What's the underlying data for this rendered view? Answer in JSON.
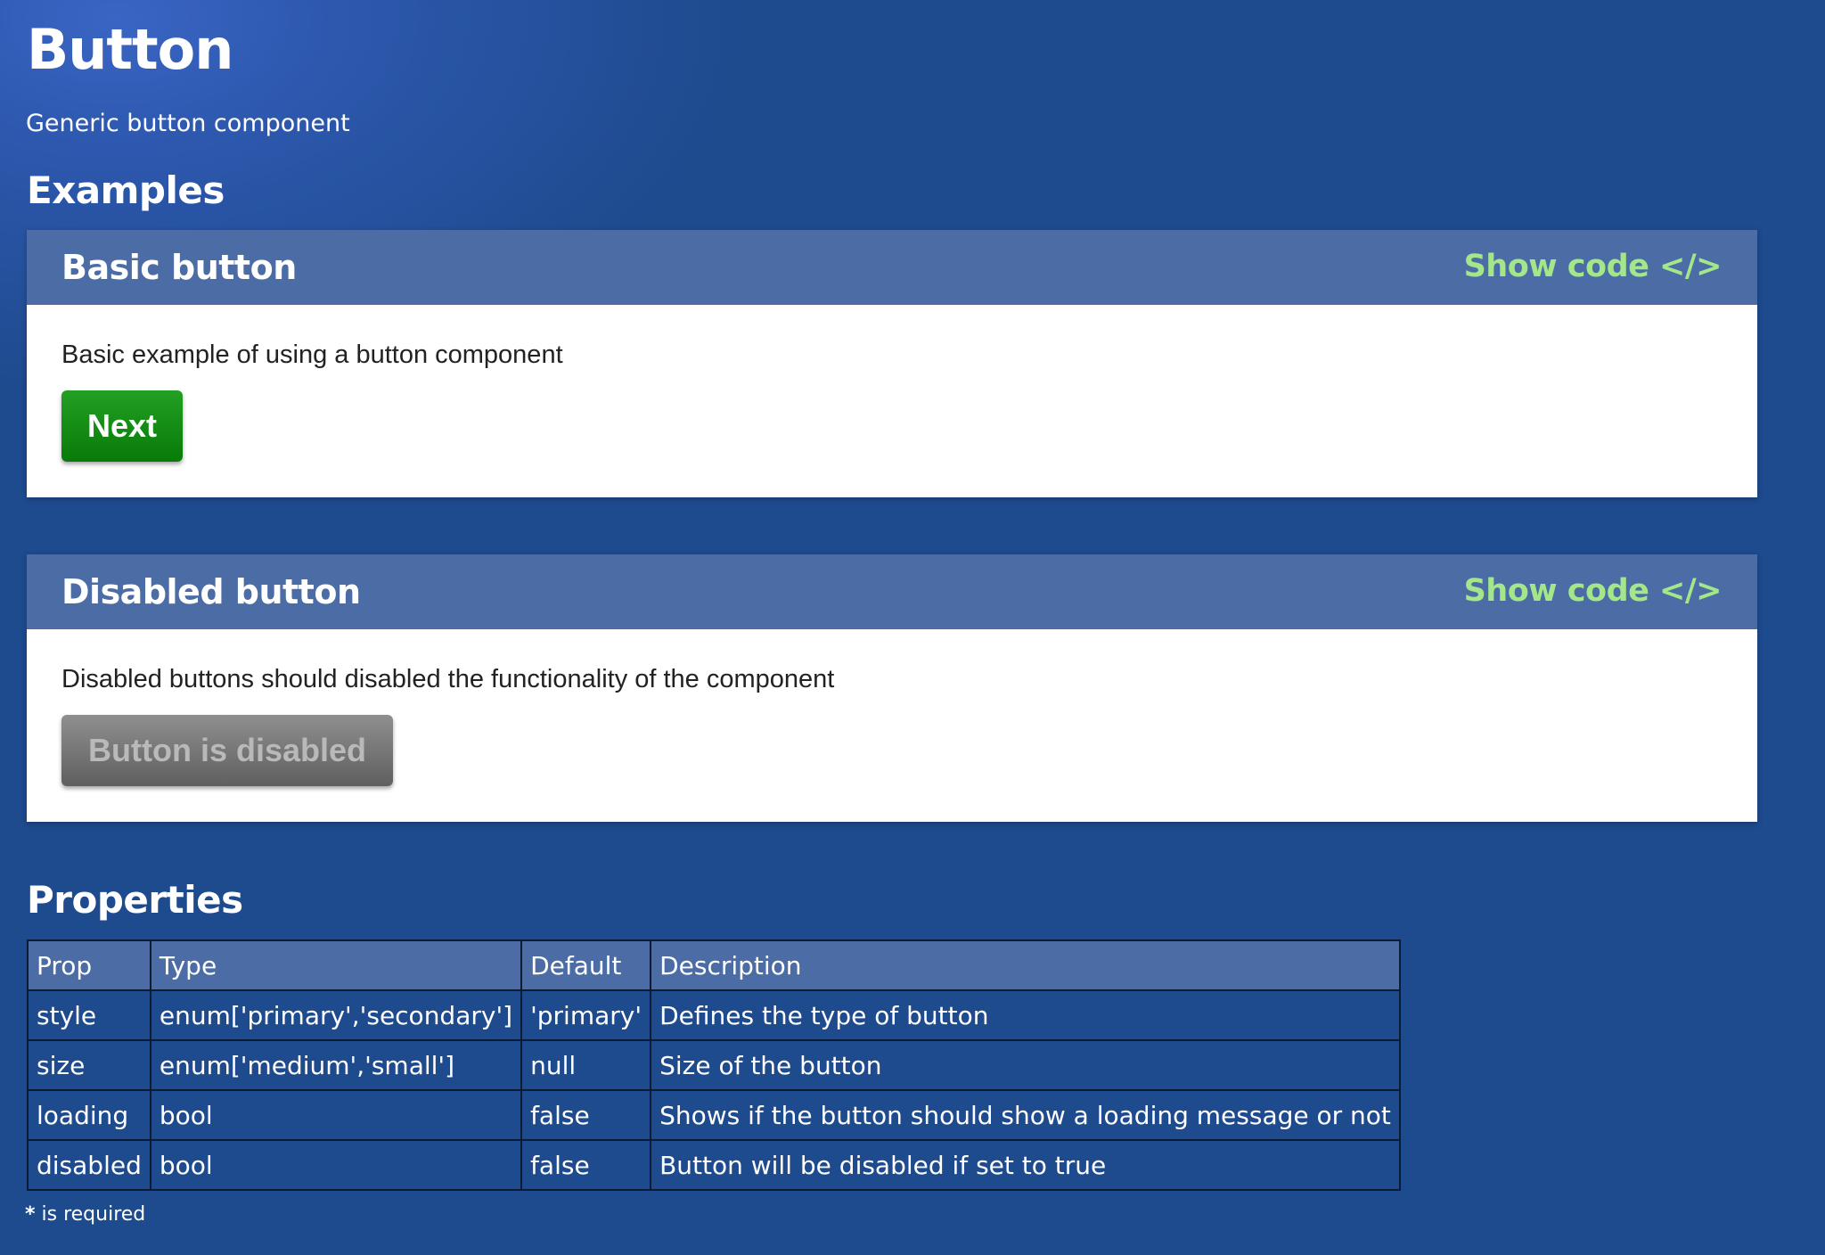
{
  "page": {
    "title": "Button",
    "subtitle": "Generic button component"
  },
  "sections": {
    "examples": "Examples",
    "properties": "Properties"
  },
  "examples": [
    {
      "title": "Basic button",
      "show_code": "Show code </>",
      "description": "Basic example of using a button component",
      "button_label": "Next",
      "button_state": "enabled"
    },
    {
      "title": "Disabled button",
      "show_code": "Show code </>",
      "description": "Disabled buttons should disabled the functionality of the component",
      "button_label": "Button is disabled",
      "button_state": "disabled"
    }
  ],
  "properties_table": {
    "headers": [
      "Prop",
      "Type",
      "Default",
      "Description"
    ],
    "rows": [
      [
        "style",
        "enum['primary','secondary']",
        "'primary'",
        "Defines the type of button"
      ],
      [
        "size",
        "enum['medium','small']",
        "null",
        "Size of the button"
      ],
      [
        "loading",
        "bool",
        "false",
        "Shows if the button should show a loading message or not"
      ],
      [
        "disabled",
        "bool",
        "false",
        "Button will be disabled if set to true"
      ]
    ]
  },
  "required_note": {
    "marker": "*",
    "text": " is required"
  },
  "colors": {
    "background": "#1e4a8e",
    "card_header": "#4b6ca4",
    "show_code": "#a4e68a",
    "primary_button": "#0b8a0b",
    "disabled_button": "#6f6f6f"
  }
}
